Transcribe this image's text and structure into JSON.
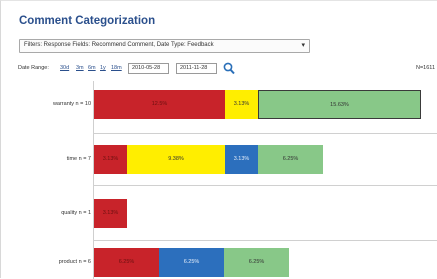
{
  "title": "Comment Categorization",
  "filter": {
    "label": "Filters: Response Fields: Recommend Comment, Date Type: Feedback"
  },
  "date_range": {
    "label": "Date Range:",
    "links": [
      "30d",
      "3m",
      "6m",
      "1y",
      "18m"
    ],
    "start": "2010-05-28",
    "end": "2011-11-28",
    "total": "N=1611"
  },
  "colors": {
    "red": "#c8232a",
    "yellow": "#ffee00",
    "blue": "#2c6fbd",
    "green": "#88c888"
  },
  "chart_data": {
    "type": "bar",
    "orientation": "horizontal",
    "stacked": true,
    "categories": [
      "warranty n = 10",
      "time n = 7",
      "quality n = 1",
      "product n = 6"
    ],
    "rows": [
      {
        "label": "warranty n = 10",
        "segments": [
          {
            "color": "red",
            "value": 12.5,
            "label": "12.5%"
          },
          {
            "color": "yellow",
            "value": 3.13,
            "label": "3.13%"
          },
          {
            "color": "green",
            "value": 15.63,
            "label": "15.63%",
            "selected": true
          }
        ]
      },
      {
        "label": "time n = 7",
        "segments": [
          {
            "color": "red",
            "value": 3.13,
            "label": "3.13%"
          },
          {
            "color": "yellow",
            "value": 9.38,
            "label": "9.38%"
          },
          {
            "color": "blue",
            "value": 3.13,
            "label": "3.13%"
          },
          {
            "color": "green",
            "value": 6.25,
            "label": "6.25%"
          }
        ]
      },
      {
        "label": "quality n = 1",
        "segments": [
          {
            "color": "red",
            "value": 3.13,
            "label": "3.13%"
          }
        ]
      },
      {
        "label": "product n = 6",
        "segments": [
          {
            "color": "red",
            "value": 6.25,
            "label": "6.25%"
          },
          {
            "color": "blue",
            "value": 6.25,
            "label": "6.25%"
          },
          {
            "color": "green",
            "value": 6.25,
            "label": "6.25%"
          }
        ]
      }
    ]
  }
}
